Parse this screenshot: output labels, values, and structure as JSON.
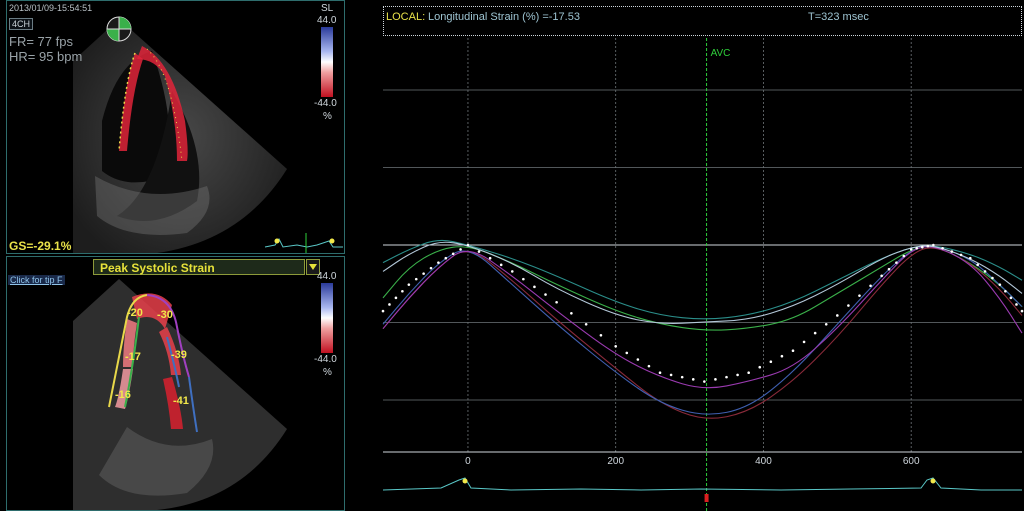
{
  "top_panel": {
    "timestamp": "2013/01/09-15:54:51",
    "view": "4CH",
    "frame_rate": "FR= 77 fps",
    "heart_rate": "HR= 95 bpm",
    "scale_label": "SL",
    "scale_max": "44.0",
    "scale_min": "-44.0",
    "scale_unit": "%",
    "global_strain": "GS=-29.1%"
  },
  "bottom_panel": {
    "title": "Peak Systolic Strain",
    "tip_link": "Click for tip F",
    "scale_max": "44.0",
    "scale_min": "-44.0",
    "scale_unit": "%",
    "segments": [
      "-20",
      "-30",
      "-17",
      "-39",
      "-16",
      "-41"
    ]
  },
  "graph": {
    "header_local": "LOCAL:",
    "header_measure": "Longitudinal Strain (%) =-17.53",
    "header_time": "T=323 msec",
    "avc_label": "AVC",
    "colors": {
      "grid": "#6e7478",
      "avc": "#2ecf3a",
      "white_dots": "#ffffff",
      "c1": "#2b8e8a",
      "c2": "#3ab04a",
      "c3": "#8a2a3a",
      "c4": "#3f5fb0",
      "c5": "#9a3ab0",
      "c6": "#b3c7d8"
    }
  },
  "chart_data": {
    "type": "line",
    "title": "",
    "xlabel": "",
    "ylabel": "",
    "x_ticks": [
      0,
      200,
      400,
      600
    ],
    "y_ticks": [
      35.2,
      17.6,
      0.0,
      -17.6,
      -35.2
    ],
    "y_tick_labels": [
      "35.2",
      "17.6",
      "0.0",
      "-17.6",
      "-35.2"
    ],
    "x_tick_labels": [
      "0",
      "200",
      "400",
      "600"
    ],
    "xlim": [
      -115,
      750
    ],
    "ylim": [
      -47,
      47
    ],
    "avc_x": 323,
    "series": [
      {
        "color": "#2b8e8a",
        "x": [
          -115,
          -80,
          -40,
          0,
          60,
          120,
          200,
          260,
          320,
          380,
          440,
          500,
          560,
          600,
          630,
          680,
          720,
          750
        ],
        "y": [
          -4,
          -1,
          1.5,
          0,
          -3,
          -7,
          -13,
          -16,
          -17,
          -16,
          -13,
          -8,
          -3,
          -0.5,
          0,
          -2,
          -5,
          -8
        ]
      },
      {
        "color": "#3ab04a",
        "x": [
          -115,
          -80,
          -40,
          0,
          60,
          120,
          200,
          260,
          320,
          380,
          440,
          500,
          560,
          600,
          630,
          680,
          720,
          750
        ],
        "y": [
          -12,
          -5,
          -1,
          0,
          -4,
          -9,
          -15,
          -18,
          -19.5,
          -19,
          -17,
          -11,
          -5,
          -1,
          0,
          -4,
          -9,
          -14
        ]
      },
      {
        "color": "#8a2a3a",
        "x": [
          -115,
          -80,
          -40,
          0,
          60,
          120,
          200,
          260,
          320,
          380,
          440,
          500,
          560,
          600,
          630,
          680,
          720,
          750
        ],
        "y": [
          -19,
          -12,
          -5,
          0,
          -8,
          -17,
          -28,
          -36,
          -40,
          -38,
          -31,
          -21,
          -9,
          -2,
          0,
          -4,
          -10,
          -16
        ]
      },
      {
        "color": "#3f5fb0",
        "x": [
          -115,
          -80,
          -40,
          0,
          60,
          120,
          200,
          260,
          320,
          380,
          440,
          500,
          560,
          600,
          630,
          680,
          720,
          750
        ],
        "y": [
          -18,
          -11,
          -4,
          0,
          -9,
          -18,
          -29,
          -36,
          -39,
          -37,
          -29,
          -18,
          -7,
          -1,
          0,
          -3,
          -9,
          -14
        ]
      },
      {
        "color": "#9a3ab0",
        "x": [
          -115,
          -80,
          -40,
          0,
          60,
          120,
          200,
          260,
          320,
          380,
          440,
          500,
          560,
          600,
          630,
          680,
          720,
          750
        ],
        "y": [
          -19,
          -12,
          -5,
          0,
          -7,
          -15,
          -25,
          -30,
          -33,
          -31,
          -28,
          -19,
          -8,
          -1,
          0,
          -4,
          -12,
          -20
        ]
      },
      {
        "color": "#b3c7d8",
        "x": [
          -115,
          -80,
          -40,
          0,
          60,
          120,
          200,
          260,
          320,
          380,
          440,
          500,
          560,
          600,
          630,
          680,
          720,
          750
        ],
        "y": [
          -6,
          -2,
          1,
          0,
          -4,
          -10,
          -16,
          -18,
          -17.5,
          -17,
          -14,
          -9,
          -3,
          -0.5,
          0,
          -3,
          -7,
          -11
        ]
      },
      {
        "color": "#ffffff",
        "dotted": true,
        "x": [
          -115,
          -80,
          -40,
          0,
          60,
          120,
          200,
          260,
          320,
          380,
          440,
          500,
          560,
          600,
          630,
          680,
          720,
          750
        ],
        "y": [
          -15,
          -9,
          -4,
          0,
          -6,
          -13,
          -23,
          -29,
          -31,
          -29,
          -24,
          -16,
          -7,
          -1,
          0,
          -3,
          -9,
          -15
        ]
      }
    ]
  }
}
